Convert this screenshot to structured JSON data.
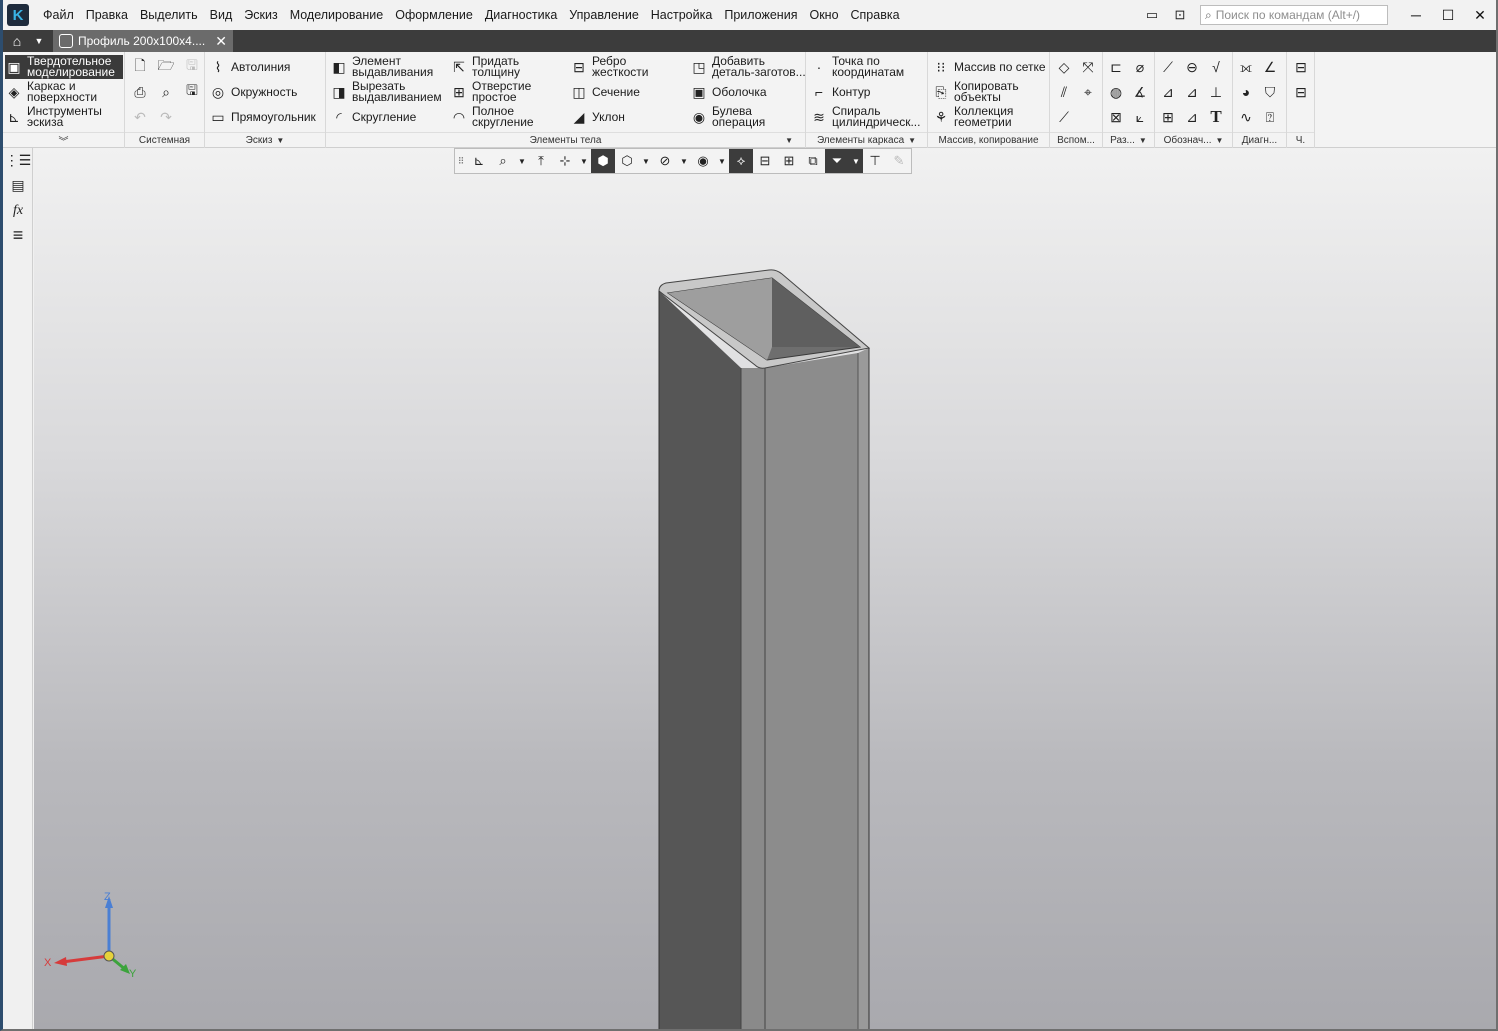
{
  "app": {
    "logo": "K",
    "menu": [
      "Файл",
      "Правка",
      "Выделить",
      "Вид",
      "Эскиз",
      "Моделирование",
      "Оформление",
      "Диагностика",
      "Управление",
      "Настройка",
      "Приложения",
      "Окно",
      "Справка"
    ],
    "search_placeholder": "Поиск по командам (Alt+/)",
    "window_controls": [
      "minimize",
      "maximize",
      "close"
    ]
  },
  "tabs": {
    "active_document": "Профиль 200х100х4...."
  },
  "ribbon": {
    "modes": [
      {
        "label1": "Твердотельное",
        "label2": "моделирование",
        "selected": true
      },
      {
        "label1": "Каркас и",
        "label2": "поверхности",
        "selected": false
      },
      {
        "label1": "Инструменты",
        "label2": "эскиза",
        "selected": false
      }
    ],
    "groups": {
      "system": "Системная",
      "sketch": "Эскиз",
      "body": "Элементы тела",
      "frame": "Элементы каркаса",
      "array": "Массив, копирование",
      "aux": "Вспом...",
      "size": "Раз...",
      "notation": "Обознач...",
      "diag": "Диагн...",
      "ch": "Ч."
    },
    "sketch_items": [
      "Автолиния",
      "Окружность",
      "Прямоугольник"
    ],
    "body_items": [
      {
        "l1": "Элемент",
        "l2": "выдавливания"
      },
      {
        "l1": "Вырезать",
        "l2": "выдавливанием"
      },
      {
        "l1": "Скругление",
        "l2": ""
      },
      {
        "l1": "Придать",
        "l2": "толщину"
      },
      {
        "l1": "Отверстие",
        "l2": "простое"
      },
      {
        "l1": "Полное",
        "l2": "скругление"
      },
      {
        "l1": "Ребро",
        "l2": "жесткости"
      },
      {
        "l1": "Сечение",
        "l2": ""
      },
      {
        "l1": "Уклон",
        "l2": ""
      },
      {
        "l1": "Добавить",
        "l2": "деталь-заготов..."
      },
      {
        "l1": "Оболочка",
        "l2": ""
      },
      {
        "l1": "Булева",
        "l2": "операция"
      }
    ],
    "frame_items": [
      {
        "l1": "Точка по",
        "l2": "координатам"
      },
      {
        "l1": "Контур",
        "l2": ""
      },
      {
        "l1": "Спираль",
        "l2": "цилиндрическ..."
      }
    ],
    "array_items": [
      {
        "l1": "Массив по сетке",
        "l2": ""
      },
      {
        "l1": "Копировать",
        "l2": "объекты"
      },
      {
        "l1": "Коллекция",
        "l2": "геометрии"
      }
    ]
  },
  "viewport": {
    "axis_labels": {
      "x": "X",
      "y": "Y",
      "z": "Z"
    },
    "colors": {
      "x": "#d63b3b",
      "y": "#3ca33c",
      "z": "#4a7fd4",
      "origin": "#e6d23a",
      "selected_mode_bg": "#3a3a3a"
    }
  }
}
